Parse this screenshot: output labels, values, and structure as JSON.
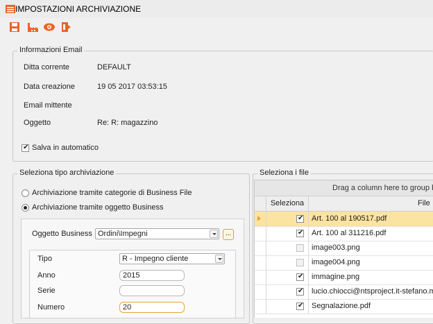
{
  "window": {
    "title": "IMPOSTAZIONI ARCHIVIAZIONE"
  },
  "toolbar": {
    "buttons": [
      {
        "icon": "save-icon"
      },
      {
        "icon": "factory-icon"
      },
      {
        "icon": "eye-icon"
      },
      {
        "icon": "exit-icon"
      }
    ]
  },
  "email_info": {
    "legend": "Informazioni Email",
    "ditta_label": "Ditta corrente",
    "ditta_value": "DEFAULT",
    "data_label": "Data creazione",
    "data_value": "19 05 2017 03:53:15",
    "mittente_label": "Email mittente",
    "mittente_value": "",
    "oggetto_label": "Oggetto",
    "oggetto_value": "Re: R: magazzino",
    "auto_save_label": "Salva in automatico",
    "auto_save_checked": true
  },
  "archive_type": {
    "legend": "Seleziona tipo archiviazione",
    "option1": "Archiviazione tramite categorie di Business File",
    "option2": "Archiviazione tramite oggetto Business",
    "selected": 2,
    "oggetto_business_label": "Oggetto Business",
    "oggetto_business_value": "Ordini\\Impegni",
    "ellipsis": "...",
    "tipo_label": "Tipo",
    "tipo_value": "R - Impegno cliente",
    "anno_label": "Anno",
    "anno_value": "2015",
    "serie_label": "Serie",
    "serie_value": "",
    "numero_label": "Numero",
    "numero_value": "20"
  },
  "files": {
    "legend": "Seleziona i file",
    "group_hint": "Drag a column here to group by",
    "col_select": "Seleziona",
    "col_file": "File",
    "rows": [
      {
        "file": "Art. 100 al 190517.pdf",
        "checked": true
      },
      {
        "file": "Art. 100 al 311216.pdf",
        "checked": true
      },
      {
        "file": "image003.png",
        "checked": false
      },
      {
        "file": "image004.png",
        "checked": false
      },
      {
        "file": "immagine.png",
        "checked": true
      },
      {
        "file": "lucio.chiocci@ntsproject.it-stefano.ma",
        "checked": true
      },
      {
        "file": "Segnalazione.pdf",
        "checked": true
      }
    ]
  }
}
